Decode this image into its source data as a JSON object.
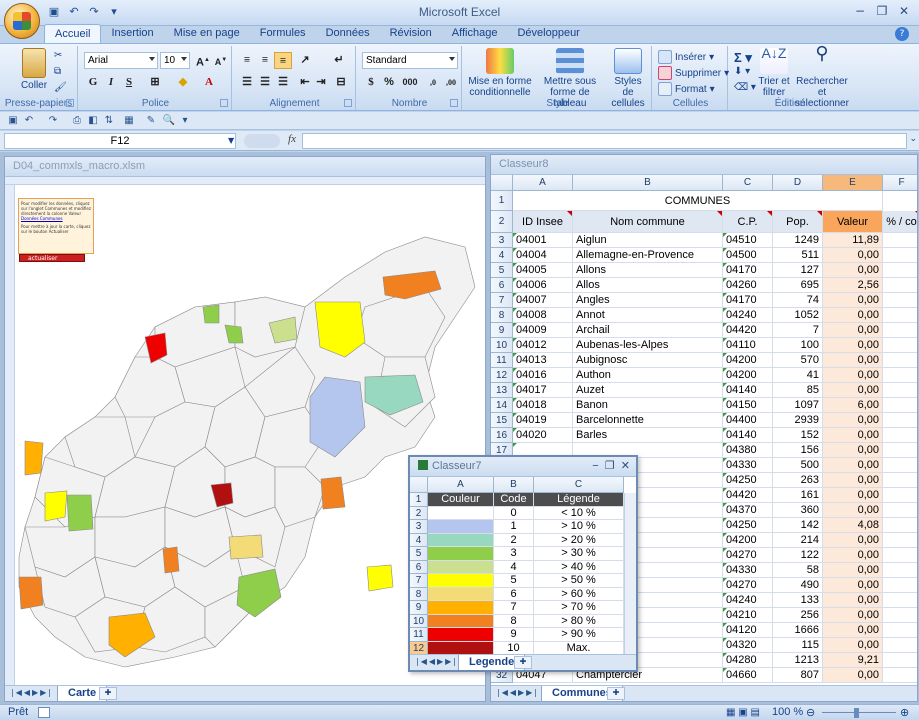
{
  "window": {
    "title": "Microsoft Excel"
  },
  "ribbon": {
    "tabs": [
      "Accueil",
      "Insertion",
      "Mise en page",
      "Formules",
      "Données",
      "Révision",
      "Affichage",
      "Développeur"
    ],
    "clipboard": {
      "paste": "Coller",
      "label": "Presse-papiers"
    },
    "font": {
      "name": "Arial",
      "size": "10",
      "bold": "G",
      "italic": "I",
      "underline": "S",
      "label": "Police"
    },
    "alignment": {
      "label": "Alignement"
    },
    "number": {
      "format": "Standard",
      "percent": "%",
      "thousands": "000",
      "label": "Nombre"
    },
    "style": {
      "conditional": "Mise en forme conditionnelle",
      "table": "Mettre sous forme de tableau",
      "cell_styles": "Styles de cellules",
      "label": "Style"
    },
    "cells": {
      "insert": "Insérer",
      "delete": "Supprimer",
      "format": "Format",
      "label": "Cellules"
    },
    "edit": {
      "sort": "Trier et filtrer",
      "find": "Rechercher et sélectionner",
      "label": "Édition"
    }
  },
  "formula_bar": {
    "name_box": "F12",
    "fx": "fx",
    "value": ""
  },
  "carte": {
    "title": "D04_commxls_macro.xlsm",
    "info": "Pour modifier les données, cliquez sur l'onglet Communes et modifiez directement la colonne Valeur",
    "info2": "Pour mettre à jour la carte, cliquez sur le bouton Actualiser",
    "link": "Données Communes",
    "button": "actualiser",
    "tab": "Carte"
  },
  "classeur8": {
    "title": "Classeur8",
    "columns": [
      "A",
      "B",
      "C",
      "D",
      "E",
      "F"
    ],
    "header_title": "COMMUNES",
    "headers": [
      "ID Insee",
      "Nom commune",
      "C.P.",
      "Pop.",
      "Valeur",
      "% / co"
    ],
    "rows": [
      [
        "04001",
        "Aiglun",
        "04510",
        "1249",
        "11,89"
      ],
      [
        "04004",
        "Allemagne-en-Provence",
        "04500",
        "511",
        "0,00"
      ],
      [
        "04005",
        "Allons",
        "04170",
        "127",
        "0,00"
      ],
      [
        "04006",
        "Allos",
        "04260",
        "695",
        "2,56"
      ],
      [
        "04007",
        "Angles",
        "04170",
        "74",
        "0,00"
      ],
      [
        "04008",
        "Annot",
        "04240",
        "1052",
        "0,00"
      ],
      [
        "04009",
        "Archail",
        "04420",
        "7",
        "0,00"
      ],
      [
        "04012",
        "Aubenas-les-Alpes",
        "04110",
        "100",
        "0,00"
      ],
      [
        "04013",
        "Aubignosc",
        "04200",
        "570",
        "0,00"
      ],
      [
        "04016",
        "Authon",
        "04200",
        "41",
        "0,00"
      ],
      [
        "04017",
        "Auzet",
        "04140",
        "85",
        "0,00"
      ],
      [
        "04018",
        "Banon",
        "04150",
        "1097",
        "6,00"
      ],
      [
        "04019",
        "Barcelonnette",
        "04400",
        "2939",
        "0,00"
      ],
      [
        "04020",
        "Barles",
        "04140",
        "152",
        "0,00"
      ],
      [
        "",
        "",
        "04380",
        "156",
        "0,00"
      ],
      [
        "",
        "",
        "04330",
        "500",
        "0,00"
      ],
      [
        "",
        "",
        "04250",
        "263",
        "0,00"
      ],
      [
        "",
        "",
        "04420",
        "161",
        "0,00"
      ],
      [
        "",
        "",
        "04370",
        "360",
        "0,00"
      ],
      [
        "",
        "",
        "04250",
        "142",
        "4,08"
      ],
      [
        "",
        "",
        "04200",
        "214",
        "0,00"
      ],
      [
        "",
        "",
        "04270",
        "122",
        "0,00"
      ],
      [
        "",
        "",
        "04330",
        "58",
        "0,00"
      ],
      [
        "",
        "",
        "04270",
        "490",
        "0,00"
      ],
      [
        "",
        "",
        "04240",
        "133",
        "0,00"
      ],
      [
        "",
        "",
        "04210",
        "256",
        "0,00"
      ],
      [
        "",
        "",
        "04120",
        "1666",
        "0,00"
      ],
      [
        "",
        "Sausses",
        "04320",
        "115",
        "0,00"
      ],
      [
        "",
        "",
        "04280",
        "1213",
        "9,21"
      ],
      [
        "04047",
        "Champtercier",
        "04660",
        "807",
        "0,00"
      ]
    ],
    "tab": "Communes"
  },
  "classeur7": {
    "title": "Classeur7",
    "columns": [
      "A",
      "B",
      "C"
    ],
    "headers": [
      "Couleur",
      "Code",
      "Légende"
    ],
    "rows": [
      {
        "code": "0",
        "legend": "< 10 %",
        "color": "#ffffff"
      },
      {
        "code": "1",
        "legend": "> 10 %",
        "color": "#b4c6ee"
      },
      {
        "code": "2",
        "legend": "> 20 %",
        "color": "#99d8c0"
      },
      {
        "code": "3",
        "legend": "> 30 %",
        "color": "#8fce4a"
      },
      {
        "code": "4",
        "legend": "> 40 %",
        "color": "#cbe08e"
      },
      {
        "code": "5",
        "legend": "> 50 %",
        "color": "#ffff00"
      },
      {
        "code": "6",
        "legend": "> 60 %",
        "color": "#f3dc77"
      },
      {
        "code": "7",
        "legend": "> 70 %",
        "color": "#ffb000"
      },
      {
        "code": "8",
        "legend": "> 80 %",
        "color": "#f08020"
      },
      {
        "code": "9",
        "legend": "> 90 %",
        "color": "#ee0000"
      },
      {
        "code": "10",
        "legend": "Max.",
        "color": "#b01010"
      }
    ],
    "tab": "Legende"
  },
  "status": {
    "ready": "Prêt",
    "zoom": "100 %"
  },
  "colors": {
    "accent": "#15428b",
    "selected_header": "#f9a55c"
  }
}
